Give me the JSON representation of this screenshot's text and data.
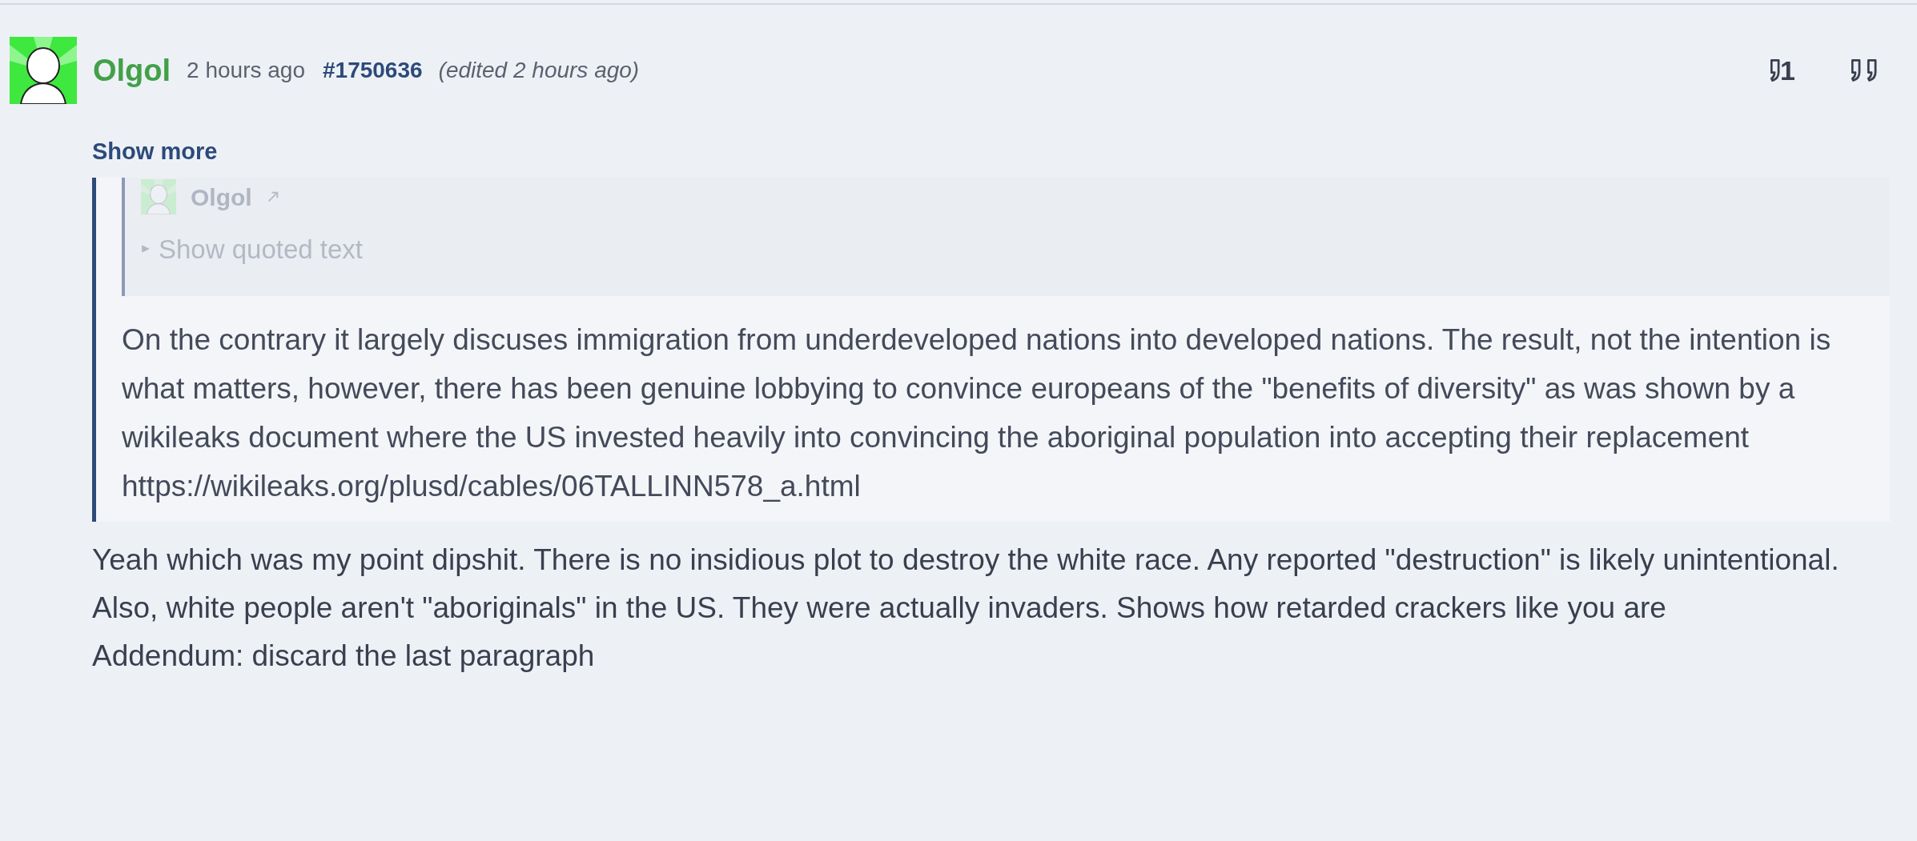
{
  "post": {
    "author": "Olgol",
    "time": "2 hours ago",
    "post_id": "#1750636",
    "edited": "(edited 2 hours ago)",
    "actions": [
      {
        "kind": "quote-reply",
        "label": "1"
      },
      {
        "kind": "quote"
      }
    ],
    "show_more": "Show more",
    "quote": {
      "nested": {
        "author": "Olgol",
        "toggle": "Show quoted text",
        "expanded": false
      },
      "text": "On the contrary it largely discuses immigration from underdeveloped nations into developed nations. The result, not the intention is what matters, however, there has been genuine lobbying to convince europeans of the \"benefits of diversity\" as was shown by a wikileaks document where the US invested heavily into convincing the aboriginal population into accepting their replacement",
      "link": "https://wikileaks.org/plusd/cables/06TALLINN578_a.html"
    },
    "paragraphs": [
      "Yeah which was my point dipshit. There is no insidious plot to destroy the white race. Any reported \"destruction\" is likely unintentional.",
      "Also, white people aren't \"aboriginals\" in the US. They were actually invaders. Shows how retarded crackers like you are",
      "Addendum: discard the last paragraph"
    ]
  }
}
